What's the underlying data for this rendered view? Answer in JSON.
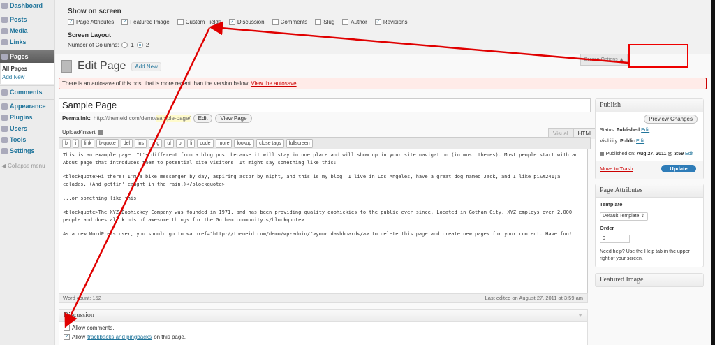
{
  "sidebar": {
    "items": [
      {
        "label": "Dashboard"
      },
      {
        "label": "Posts"
      },
      {
        "label": "Media"
      },
      {
        "label": "Links"
      },
      {
        "label": "Pages"
      },
      {
        "label": "Comments"
      },
      {
        "label": "Appearance"
      },
      {
        "label": "Plugins"
      },
      {
        "label": "Users"
      },
      {
        "label": "Tools"
      },
      {
        "label": "Settings"
      }
    ],
    "submenu": {
      "all_pages": "All Pages",
      "add_new": "Add New"
    },
    "collapse": "Collapse menu"
  },
  "screen_options": {
    "title": "Show on screen",
    "options": [
      {
        "label": "Page Attributes",
        "checked": "✓"
      },
      {
        "label": "Featured Image",
        "checked": "✓"
      },
      {
        "label": "Custom Fields",
        "checked": ""
      },
      {
        "label": "Discussion",
        "checked": "✓"
      },
      {
        "label": "Comments",
        "checked": ""
      },
      {
        "label": "Slug",
        "checked": ""
      },
      {
        "label": "Author",
        "checked": ""
      },
      {
        "label": "Revisions",
        "checked": "✓"
      }
    ],
    "layout_title": "Screen Layout",
    "columns_label": "Number of Columns:",
    "col1": "1",
    "col2": "2",
    "tab_label": "Screen Options ▲"
  },
  "header": {
    "title": "Edit Page",
    "add_new": "Add New"
  },
  "notice": {
    "text": "There is an autosave of this post that is more recent than the version below. ",
    "link": "View the autosave"
  },
  "post": {
    "title": "Sample Page",
    "permalink_label": "Permalink:",
    "permalink_base": "http://themeid.com/demo/",
    "permalink_slug": "sample-page/",
    "edit_btn": "Edit",
    "view_btn": "View Page"
  },
  "editor": {
    "upload_label": "Upload/Insert",
    "tab_visual": "Visual",
    "tab_html": "HTML",
    "quicktags": [
      "b",
      "i",
      "link",
      "b-quote",
      "del",
      "ins",
      "img",
      "ul",
      "ol",
      "li",
      "code",
      "more",
      "lookup",
      "close tags",
      "fullscreen"
    ],
    "p1": "This is an example page. It's different from a blog post because it will stay in one place and will show up in your site navigation (in most themes). Most people start with an About page that introduces them to potential site visitors. It might say something like this:",
    "p2": "<blockquote>Hi there! I'm a bike messenger by day, aspiring actor by night, and this is my blog. I live in Los Angeles, have a great dog named Jack, and I like pi&#241;a coladas. (And gettin' caught in the rain.)</blockquote>",
    "p3": "...or something like this:",
    "p4": "<blockquote>The XYZ Doohickey Company was founded in 1971, and has been providing quality doohickies to the public ever since. Located in Gotham City, XYZ employs over 2,000 people and does all kinds of awesome things for the Gotham community.</blockquote>",
    "p5": "As a new WordPress user, you should go to <a href=\"http://themeid.com/demo/wp-admin/\">your dashboard</a> to delete this page and create new pages for your content. Have fun!",
    "word_count": "Word count: 152",
    "last_edited": "Last edited on August 27, 2011 at 3:59 am"
  },
  "discussion": {
    "title": "Discussion",
    "allow_comments": "Allow comments.",
    "allow_prefix": "Allow ",
    "trackbacks_link": "trackbacks and pingbacks",
    "allow_suffix": " on this page."
  },
  "publish": {
    "title": "Publish",
    "preview": "Preview Changes",
    "status_label": "Status: ",
    "status_value": "Published",
    "visibility_label": "Visibility: ",
    "visibility_value": "Public",
    "published_label": "Published on: ",
    "published_value": "Aug 27, 2011 @ 3:59",
    "edit": "Edit",
    "trash": "Move to Trash",
    "update": "Update"
  },
  "page_attributes": {
    "title": "Page Attributes",
    "template_label": "Template",
    "template_value": "Default Template ⇕",
    "order_label": "Order",
    "order_value": "0",
    "help": "Need help? Use the Help tab in the upper right of your screen."
  },
  "featured_image": {
    "title": "Featured Image"
  },
  "colors": {
    "accent": "#21759b",
    "annotation": "#e00000",
    "update_button": "#2e7cb8"
  }
}
